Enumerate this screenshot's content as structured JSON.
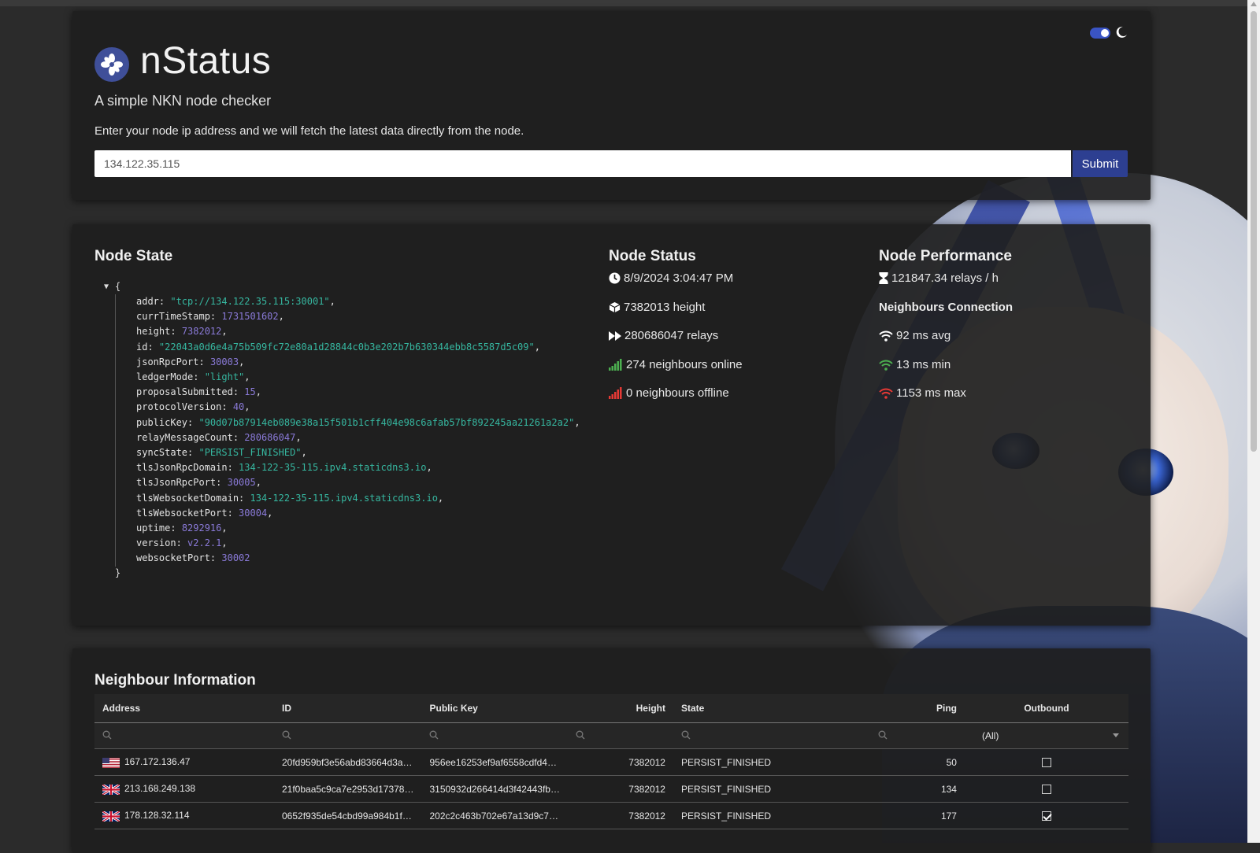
{
  "header": {
    "title": "nStatus",
    "subtitle": "A simple NKN node checker",
    "instructions": "Enter your node ip address and we will fetch the latest data directly from the node.",
    "ip_value": "134.122.35.115",
    "submit_label": "Submit"
  },
  "node_state": {
    "title": "Node State",
    "open_brace": "{",
    "close_brace": "}",
    "fields": [
      {
        "key": "addr",
        "value": "\"tcp://134.122.35.115:30001\"",
        "type": "s"
      },
      {
        "key": "currTimeStamp",
        "value": "1731501602",
        "type": "n"
      },
      {
        "key": "height",
        "value": "7382012",
        "type": "n"
      },
      {
        "key": "id",
        "value": "\"22043a0d6e4a75b509fc72e80a1d28844c0b3e202b7b630344ebb8c5587d5c09\"",
        "type": "s"
      },
      {
        "key": "jsonRpcPort",
        "value": "30003",
        "type": "n"
      },
      {
        "key": "ledgerMode",
        "value": "\"light\"",
        "type": "s"
      },
      {
        "key": "proposalSubmitted",
        "value": "15",
        "type": "n"
      },
      {
        "key": "protocolVersion",
        "value": "40",
        "type": "n"
      },
      {
        "key": "publicKey",
        "value": "\"90d07b87914eb089e38a15f501b1cff404e98c6afab57bf892245aa21261a2a2\"",
        "type": "s"
      },
      {
        "key": "relayMessageCount",
        "value": "280686047",
        "type": "n"
      },
      {
        "key": "syncState",
        "value": "\"PERSIST_FINISHED\"",
        "type": "s"
      },
      {
        "key": "tlsJsonRpcDomain",
        "value": "134-122-35-115.ipv4.staticdns3.io",
        "type": "l"
      },
      {
        "key": "tlsJsonRpcPort",
        "value": "30005",
        "type": "n"
      },
      {
        "key": "tlsWebsocketDomain",
        "value": "134-122-35-115.ipv4.staticdns3.io",
        "type": "l"
      },
      {
        "key": "tlsWebsocketPort",
        "value": "30004",
        "type": "n"
      },
      {
        "key": "uptime",
        "value": "8292916",
        "type": "n"
      },
      {
        "key": "version",
        "value": "v2.2.1",
        "type": "n"
      },
      {
        "key": "websocketPort",
        "value": "30002",
        "type": "n"
      }
    ]
  },
  "node_status": {
    "title": "Node Status",
    "timestamp": "8/9/2024 3:04:47 PM",
    "height": "7382013 height",
    "relays": "280686047 relays",
    "online": "274 neighbours online",
    "offline": "0 neighbours offline"
  },
  "node_performance": {
    "title": "Node Performance",
    "rate": "121847.34 relays / h",
    "neighbours_title": "Neighbours Connection",
    "avg": "92 ms avg",
    "min": "13 ms min",
    "max": "1153 ms max"
  },
  "neighbours": {
    "title": "Neighbour Information",
    "columns": {
      "address": "Address",
      "id": "ID",
      "public_key": "Public Key",
      "height": "Height",
      "state": "State",
      "ping": "Ping",
      "outbound": "Outbound"
    },
    "outbound_filter": "(All)",
    "rows": [
      {
        "flag": "us",
        "address": "167.172.136.47",
        "id": "20fd959bf3e56abd83664d3a…",
        "public_key": "956ee16253ef9af6558cdfd4…",
        "height": "7382012",
        "state": "PERSIST_FINISHED",
        "ping": "50",
        "outbound": false
      },
      {
        "flag": "gb",
        "address": "213.168.249.138",
        "id": "21f0baa5c9ca7e2953d17378…",
        "public_key": "3150932d266414d3f42443fb…",
        "height": "7382012",
        "state": "PERSIST_FINISHED",
        "ping": "134",
        "outbound": false
      },
      {
        "flag": "gb",
        "address": "178.128.32.114",
        "id": "0652f935de54cbd99a984b1f…",
        "public_key": "202c2c463b702e67a13d9c7…",
        "height": "7382012",
        "state": "PERSIST_FINISHED",
        "ping": "177",
        "outbound": true
      }
    ]
  },
  "colors": {
    "accent": "#2d3f91",
    "online_bars": "#4caf50",
    "offline_bars": "#e53935",
    "wifi_min": "#4caf50",
    "wifi_max": "#e53935"
  }
}
